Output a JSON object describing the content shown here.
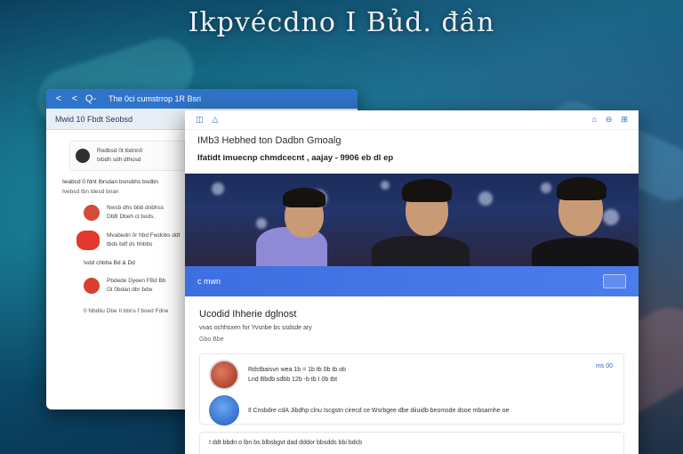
{
  "hero": {
    "title": "Ikpvécdno I Bủd. đần"
  },
  "back_window": {
    "nav": {
      "back": "<",
      "forward": "<",
      "search": "Q-"
    },
    "title": "The 0ci cumstrrop 1R Bsri",
    "header": "Mwid 10 Fbdt Seobsd",
    "notification": {
      "line1": "Redbsd 0t tbdnn0",
      "line2": "txbdh sdh dthosd"
    },
    "section": {
      "label": "Iwabcd 0 fdnt Ibrsdan bsnsbhs bodbn",
      "sub": "Ivebsd tbn ldesd bnan"
    },
    "feed": [
      {
        "line1": "Nwsb dhs bbb dnbhss",
        "line2": "DbB Dbeh cl bods."
      },
      {
        "line1": "Mvabedn 0r hbd Fwdobs ddt",
        "line2": "tbds bdf ds hhbbs"
      },
      {
        "line1": "Ivdd chbha Bd & Dd",
        "line2": ""
      },
      {
        "line1": "Pbdede Dyeen FBd Bb",
        "line2": "Gl 0bdan dbr bdw"
      }
    ],
    "footer": "0 Nbdiiu Dbe II bbns f boed Fdne"
  },
  "front_window": {
    "toolbar": {
      "left_icons": [
        "◫",
        "△"
      ],
      "right_icons": [
        "⌂",
        "⊖",
        "⊞"
      ]
    },
    "title": "IMb3 Hebhed ton Dadbn Gmoalg",
    "subtitle": "Ifatidt imuecnp chmdcecnt , aajay - 9906 eb dl ep",
    "banner": {
      "text": "c mwn"
    },
    "recent": {
      "title": "Ucodid Ihherie dglnost",
      "sub": "vnas ochhsxen for Yvsnbe bs ssdsde ary",
      "meta": "Gbo Bbe"
    },
    "post": {
      "line1": "Rdstbaisvn wea 1b  =  1b  tb  0b   tb  ob",
      "line2": "Lnd Bbdb sdbb 12b  -b  tb  I  0b  tbt",
      "count": "ms 00",
      "line3": "Il Cnsbdre cdA Jibdhp clnu Iscgstn cirecd ce Wsrbgee dbe diiuidb  beomsde dsoe mbsarnhe oe"
    },
    "post2": "I ddt bbdn o lbn bs blbsbgvt dad dddor bbsdds bbi bdcb"
  }
}
